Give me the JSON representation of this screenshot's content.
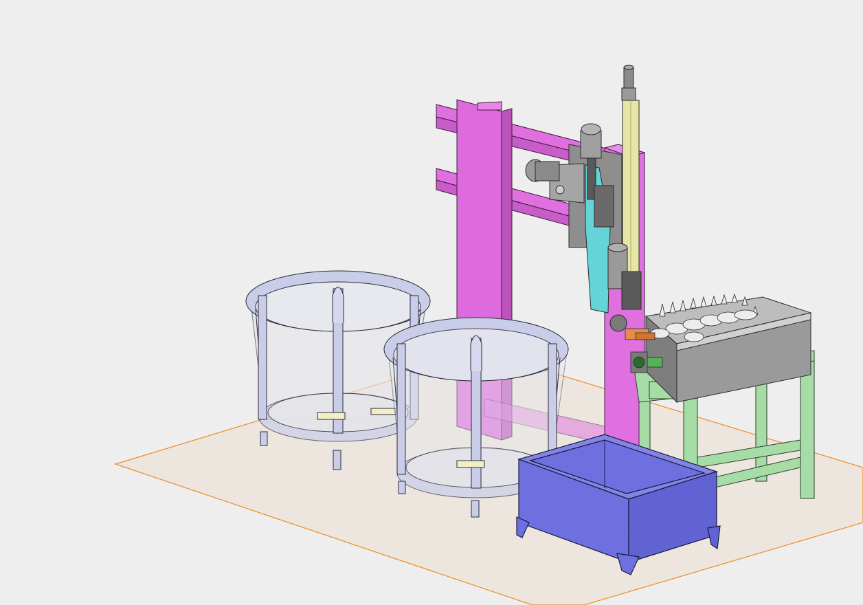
{
  "viewport": {
    "background": "#eeeeee",
    "ground_plane_color": "#ede6df",
    "ground_outline_color": "#f08a24"
  },
  "components": {
    "frame_color": "#e070e0",
    "basket_color": "#c9cde8",
    "bin_color": "#6e70e0",
    "stand_color": "#a6dca6",
    "tray_color": "#9a9a9a",
    "gripper_color": "#64d4d8",
    "actuator_rod_color": "#e6e6a8",
    "motor_color": "#8a8a8a"
  }
}
